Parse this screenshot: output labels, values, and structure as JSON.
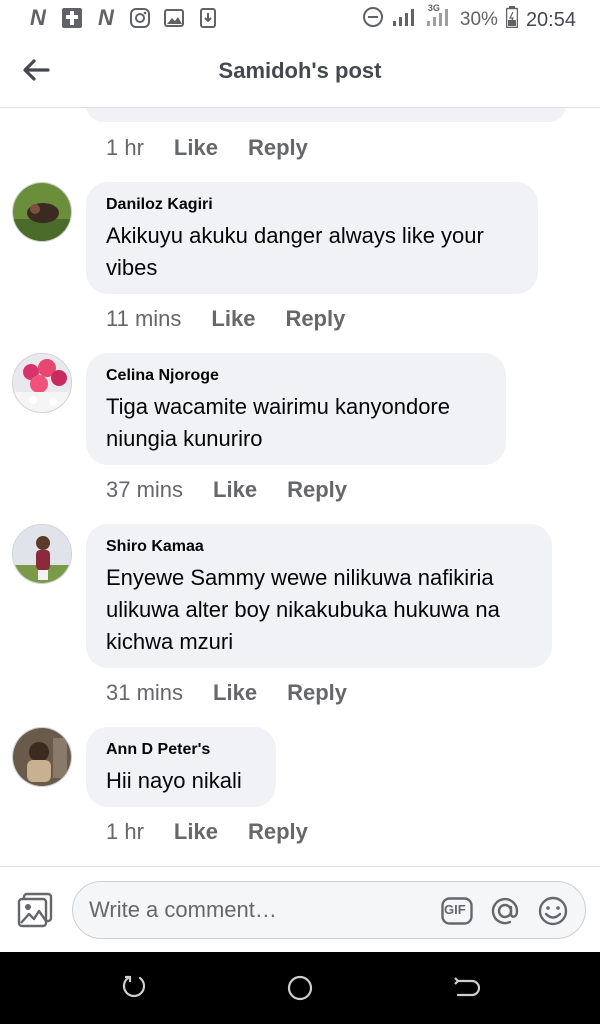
{
  "status_bar": {
    "percent": "30%",
    "time": "20:54",
    "network": "3G"
  },
  "header": {
    "title": "Samidoh's post"
  },
  "comments": [
    {
      "time": "1 hr",
      "like": "Like",
      "reply": "Reply"
    },
    {
      "author": "Daniloz Kagiri",
      "text": "Akikuyu akuku danger always  like your vibes",
      "time": "11 mins",
      "like": "Like",
      "reply": "Reply"
    },
    {
      "author": "Celina Njoroge",
      "text": "Tiga wacamite wairimu kanyondore niungia kunuriro",
      "time": "37 mins",
      "like": "Like",
      "reply": "Reply"
    },
    {
      "author": "Shiro Kamaa",
      "text": "Enyewe Sammy wewe nilikuwa nafikiria ulikuwa alter boy nikakubuka hukuwa na kichwa mzuri",
      "time": "31 mins",
      "like": "Like",
      "reply": "Reply"
    },
    {
      "author": "Ann D Peter's",
      "text": "Hii nayo nikali",
      "time": "1 hr",
      "like": "Like",
      "reply": "Reply"
    }
  ],
  "composer": {
    "placeholder": "Write a comment…",
    "gif_label": "GIF"
  },
  "icons": {
    "back": "arrow-left-icon",
    "photo": "photo-icon",
    "gif": "gif-icon",
    "mention": "at-icon",
    "emoji": "smiley-icon"
  },
  "colors": {
    "bubble": "#f0f2f5",
    "meta_text": "#65676b",
    "title": "#444950"
  }
}
